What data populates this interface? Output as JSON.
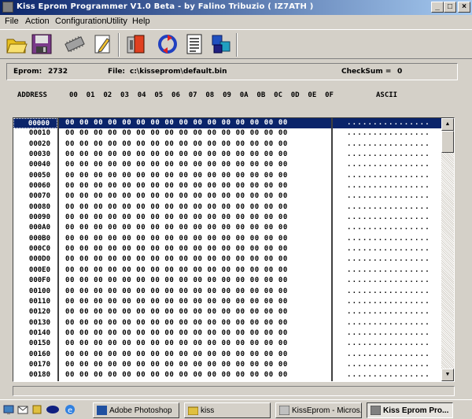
{
  "window": {
    "title": "Kiss Eprom Programmer V1.0 Beta -  by Falino Tribuzio ( IZ7ATH )",
    "minimize_label": "_",
    "maximize_label": "□",
    "close_label": "×"
  },
  "menu": {
    "items": [
      {
        "label": "File",
        "icon": "",
        "hotkey": "F"
      },
      {
        "label": "Action"
      },
      {
        "label": "Configuration"
      },
      {
        "label": "Utility"
      },
      {
        "label": "Help"
      }
    ]
  },
  "toolbar": {
    "buttons": [
      {
        "name": "open-folder-icon"
      },
      {
        "name": "save-disk-icon"
      },
      {
        "name": "chip-icon"
      },
      {
        "name": "edit-pencil-icon"
      },
      {
        "name": "read-eprom-icon"
      },
      {
        "name": "reload-icon"
      },
      {
        "name": "document-list-icon"
      },
      {
        "name": "blocks-program-icon"
      }
    ]
  },
  "info": {
    "eprom_label": "Eprom:",
    "eprom_value": "2732",
    "file_label": "File:",
    "file_value": "c:\\kisseprom\\default.bin",
    "checksum_label": "CheckSum =",
    "checksum_value": "0"
  },
  "header": {
    "address_label": "ADDRESS",
    "columns": "00  01  02  03  04  05  06  07  08  09  0A  0B  0C  0D  0E  0F",
    "ascii_label": "ASCII"
  },
  "grid": {
    "rows": [
      {
        "addr": "00000",
        "hex": "00 00 00 00 00 00 00 00 00 00 00 00 00 00 00 00",
        "ascii": "................"
      },
      {
        "addr": "00010",
        "hex": "00 00 00 00 00 00 00 00 00 00 00 00 00 00 00 00",
        "ascii": "................"
      },
      {
        "addr": "00020",
        "hex": "00 00 00 00 00 00 00 00 00 00 00 00 00 00 00 00",
        "ascii": "................"
      },
      {
        "addr": "00030",
        "hex": "00 00 00 00 00 00 00 00 00 00 00 00 00 00 00 00",
        "ascii": "................"
      },
      {
        "addr": "00040",
        "hex": "00 00 00 00 00 00 00 00 00 00 00 00 00 00 00 00",
        "ascii": "................"
      },
      {
        "addr": "00050",
        "hex": "00 00 00 00 00 00 00 00 00 00 00 00 00 00 00 00",
        "ascii": "................"
      },
      {
        "addr": "00060",
        "hex": "00 00 00 00 00 00 00 00 00 00 00 00 00 00 00 00",
        "ascii": "................"
      },
      {
        "addr": "00070",
        "hex": "00 00 00 00 00 00 00 00 00 00 00 00 00 00 00 00",
        "ascii": "................"
      },
      {
        "addr": "00080",
        "hex": "00 00 00 00 00 00 00 00 00 00 00 00 00 00 00 00",
        "ascii": "................"
      },
      {
        "addr": "00090",
        "hex": "00 00 00 00 00 00 00 00 00 00 00 00 00 00 00 00",
        "ascii": "................"
      },
      {
        "addr": "000A0",
        "hex": "00 00 00 00 00 00 00 00 00 00 00 00 00 00 00 00",
        "ascii": "................"
      },
      {
        "addr": "000B0",
        "hex": "00 00 00 00 00 00 00 00 00 00 00 00 00 00 00 00",
        "ascii": "................"
      },
      {
        "addr": "000C0",
        "hex": "00 00 00 00 00 00 00 00 00 00 00 00 00 00 00 00",
        "ascii": "................"
      },
      {
        "addr": "000D0",
        "hex": "00 00 00 00 00 00 00 00 00 00 00 00 00 00 00 00",
        "ascii": "................"
      },
      {
        "addr": "000E0",
        "hex": "00 00 00 00 00 00 00 00 00 00 00 00 00 00 00 00",
        "ascii": "................"
      },
      {
        "addr": "000F0",
        "hex": "00 00 00 00 00 00 00 00 00 00 00 00 00 00 00 00",
        "ascii": "................"
      },
      {
        "addr": "00100",
        "hex": "00 00 00 00 00 00 00 00 00 00 00 00 00 00 00 00",
        "ascii": "................"
      },
      {
        "addr": "00110",
        "hex": "00 00 00 00 00 00 00 00 00 00 00 00 00 00 00 00",
        "ascii": "................"
      },
      {
        "addr": "00120",
        "hex": "00 00 00 00 00 00 00 00 00 00 00 00 00 00 00 00",
        "ascii": "................"
      },
      {
        "addr": "00130",
        "hex": "00 00 00 00 00 00 00 00 00 00 00 00 00 00 00 00",
        "ascii": "................"
      },
      {
        "addr": "00140",
        "hex": "00 00 00 00 00 00 00 00 00 00 00 00 00 00 00 00",
        "ascii": "................"
      },
      {
        "addr": "00150",
        "hex": "00 00 00 00 00 00 00 00 00 00 00 00 00 00 00 00",
        "ascii": "................"
      },
      {
        "addr": "00160",
        "hex": "00 00 00 00 00 00 00 00 00 00 00 00 00 00 00 00",
        "ascii": "................"
      },
      {
        "addr": "00170",
        "hex": "00 00 00 00 00 00 00 00 00 00 00 00 00 00 00 00",
        "ascii": "................"
      },
      {
        "addr": "00180",
        "hex": "00 00 00 00 00 00 00 00 00 00 00 00 00 00 00 00",
        "ascii": "................"
      }
    ]
  },
  "taskbar": {
    "tasks": [
      {
        "label": "Adobe Photoshop",
        "active": false
      },
      {
        "label": "kiss",
        "active": false
      },
      {
        "label": "KissEprom - Micros...",
        "active": false
      },
      {
        "label": "Kiss Eprom Pro...",
        "active": true
      }
    ]
  },
  "colors": {
    "selection": "#0a246a",
    "face": "#d4d0c8",
    "window_bg": "#ffffff"
  }
}
